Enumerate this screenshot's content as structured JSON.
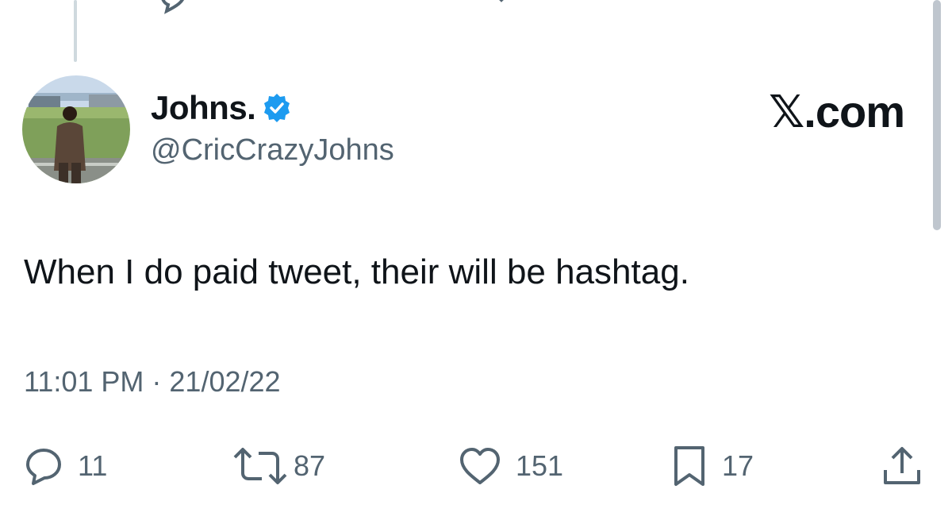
{
  "author": {
    "display_name": "Johns.",
    "handle": "@CricCrazyJohns",
    "verified": true
  },
  "brand": "𝕏.com",
  "tweet": {
    "text": "When I do paid tweet, their will be hashtag.",
    "timestamp": "11:01 PM · 21/02/22"
  },
  "actions": {
    "replies": "11",
    "retweets": "87",
    "likes": "151",
    "bookmarks": "17"
  },
  "colors": {
    "verified": "#1d9bf0",
    "secondary_text": "#536471",
    "primary_text": "#0f1419"
  },
  "icons": {
    "reply": "reply-icon",
    "retweet": "retweet-icon",
    "like": "heart-icon",
    "bookmark": "bookmark-icon",
    "share": "share-icon",
    "verified": "verified-badge-icon"
  }
}
